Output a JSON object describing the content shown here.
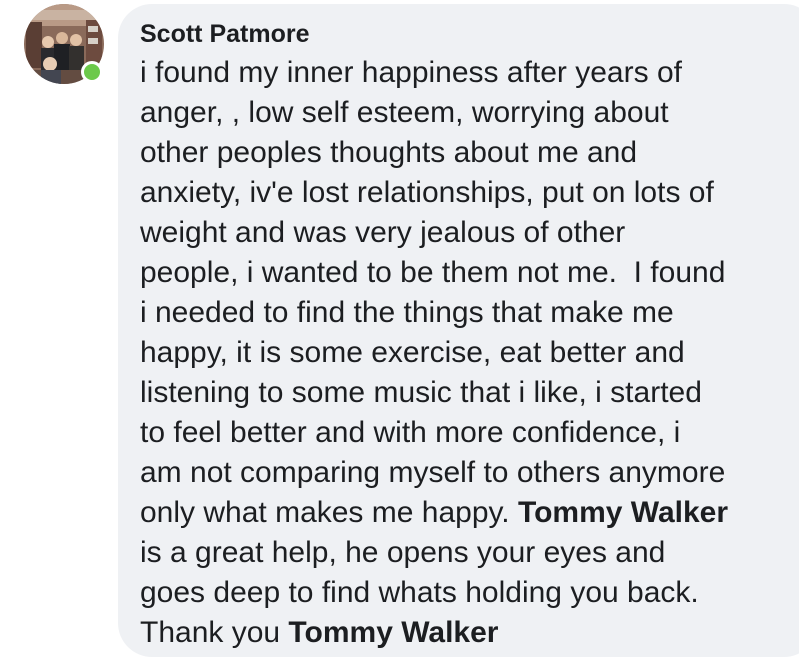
{
  "comment": {
    "author": "Scott Patmore",
    "presence": "online",
    "colors": {
      "bubble": "#eff1f4",
      "text": "#1c1e21",
      "presence": "#6cc94a"
    },
    "lines": [
      [
        {
          "text": "i found my inner happiness after years of",
          "mention": false
        }
      ],
      [
        {
          "text": "anger, , low self esteem, worrying about",
          "mention": false
        }
      ],
      [
        {
          "text": "other peoples thoughts about me and",
          "mention": false
        }
      ],
      [
        {
          "text": "anxiety, iv'e lost relationships, put on lots of",
          "mention": false
        }
      ],
      [
        {
          "text": "weight and was very jealous of other",
          "mention": false
        }
      ],
      [
        {
          "text": "people, i wanted to be them not me.  I found",
          "mention": false
        }
      ],
      [
        {
          "text": "i needed to find the things that make me",
          "mention": false
        }
      ],
      [
        {
          "text": "happy, it is some exercise, eat better and",
          "mention": false
        }
      ],
      [
        {
          "text": "listening to some music that i like, i started",
          "mention": false
        }
      ],
      [
        {
          "text": "to feel better and with more confidence, i",
          "mention": false
        }
      ],
      [
        {
          "text": "am not comparing myself to others anymore",
          "mention": false
        }
      ],
      [
        {
          "text": "only what makes me happy. ",
          "mention": false
        },
        {
          "text": "Tommy Walker",
          "mention": true
        }
      ],
      [
        {
          "text": "is a great help, he opens your eyes and",
          "mention": false
        }
      ],
      [
        {
          "text": "goes deep to find whats holding you back.",
          "mention": false
        }
      ],
      [
        {
          "text": "Thank you ",
          "mention": false
        },
        {
          "text": "Tommy Walker",
          "mention": true
        }
      ]
    ]
  }
}
